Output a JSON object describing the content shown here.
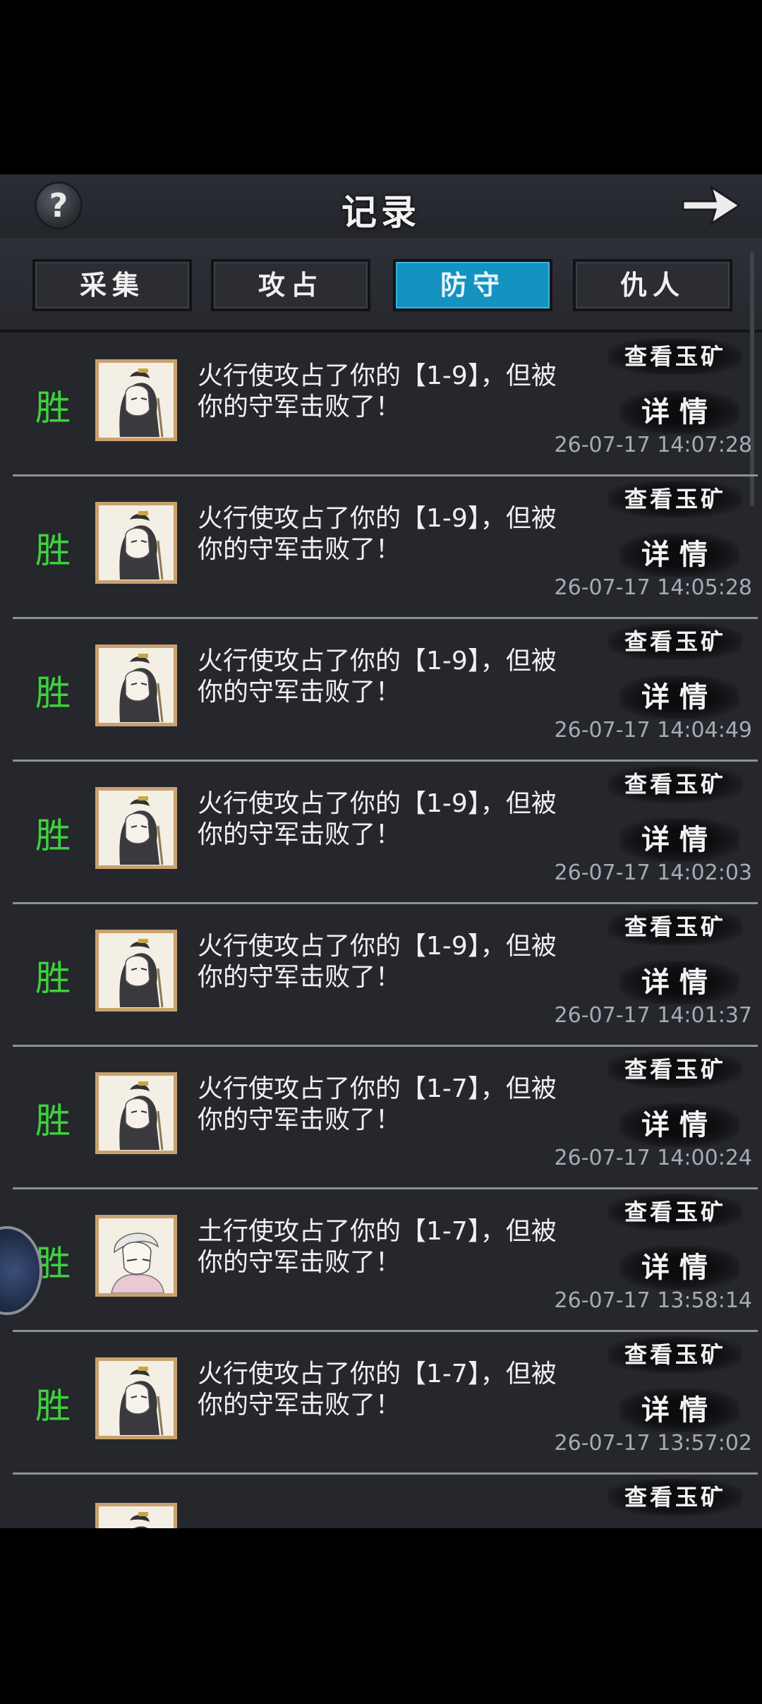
{
  "header": {
    "title": "记录",
    "help_icon": "?",
    "next_icon": "arrow-right-icon"
  },
  "tabs": [
    {
      "label": "采集",
      "active": false
    },
    {
      "label": "攻占",
      "active": false
    },
    {
      "label": "防守",
      "active": true
    },
    {
      "label": "仇人",
      "active": false
    }
  ],
  "colors": {
    "win_text": "#3dd23d",
    "active_tab": "#1493c0",
    "panel_bg": "#25272d",
    "timestamp": "#a7abb2"
  },
  "records": [
    {
      "result": "胜",
      "avatar": "female-general-avatar",
      "message": "火行使攻占了你的【1-9】，但被\n你的守军击败了！",
      "view_label": "查看玉矿",
      "detail_label": "详情",
      "time": "26-07-17 14:07:28"
    },
    {
      "result": "胜",
      "avatar": "female-general-avatar",
      "message": "火行使攻占了你的【1-9】，但被\n你的守军击败了！",
      "view_label": "查看玉矿",
      "detail_label": "详情",
      "time": "26-07-17 14:05:28"
    },
    {
      "result": "胜",
      "avatar": "female-general-avatar",
      "message": "火行使攻占了你的【1-9】，但被\n你的守军击败了！",
      "view_label": "查看玉矿",
      "detail_label": "详情",
      "time": "26-07-17 14:04:49"
    },
    {
      "result": "胜",
      "avatar": "female-general-avatar",
      "message": "火行使攻占了你的【1-9】，但被\n你的守军击败了！",
      "view_label": "查看玉矿",
      "detail_label": "详情",
      "time": "26-07-17 14:02:03"
    },
    {
      "result": "胜",
      "avatar": "female-general-avatar",
      "message": "火行使攻占了你的【1-9】，但被\n你的守军击败了！",
      "view_label": "查看玉矿",
      "detail_label": "详情",
      "time": "26-07-17 14:01:37"
    },
    {
      "result": "胜",
      "avatar": "female-general-avatar",
      "message": "火行使攻占了你的【1-7】，但被\n你的守军击败了！",
      "view_label": "查看玉矿",
      "detail_label": "详情",
      "time": "26-07-17 14:00:24"
    },
    {
      "result": "胜",
      "avatar": "white-hair-warrior-avatar",
      "message": "土行使攻占了你的【1-7】，但被\n你的守军击败了！",
      "view_label": "查看玉矿",
      "detail_label": "详情",
      "time": "26-07-17 13:58:14"
    },
    {
      "result": "胜",
      "avatar": "female-general-avatar",
      "message": "火行使攻占了你的【1-7】，但被\n你的守军击败了！",
      "view_label": "查看玉矿",
      "detail_label": "详情",
      "time": "26-07-17 13:57:02"
    }
  ],
  "partial_record": {
    "avatar": "female-general-avatar",
    "view_label": "查看玉矿"
  }
}
